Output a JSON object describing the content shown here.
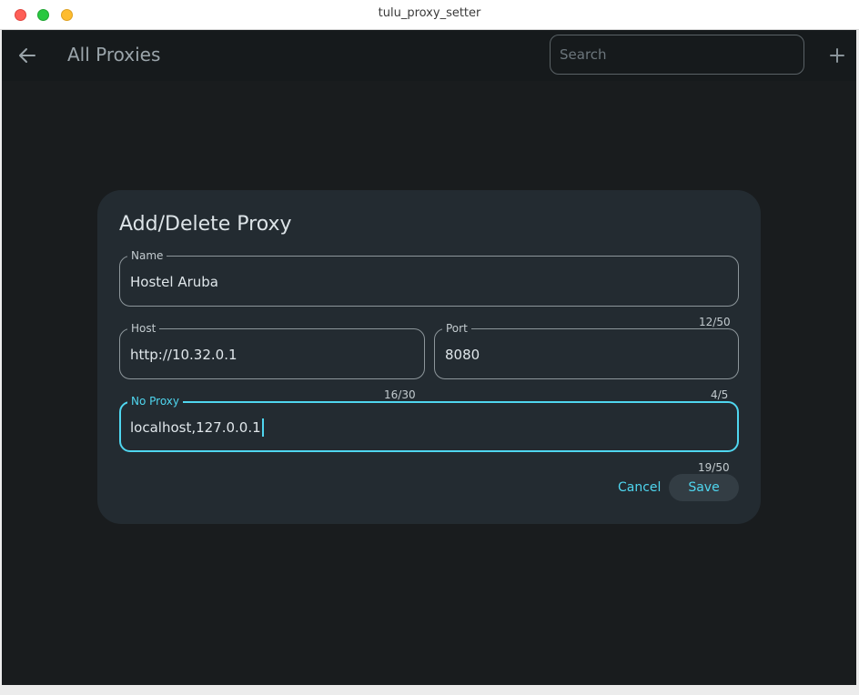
{
  "window": {
    "title": "tulu_proxy_setter"
  },
  "appbar": {
    "back_icon": "arrow-left-icon",
    "title": "All Proxies",
    "search_placeholder": "Search",
    "search_value": "",
    "add_icon": "plus-icon"
  },
  "dialog": {
    "title": "Add/Delete Proxy",
    "name": {
      "label": "Name",
      "value": "Hostel Aruba",
      "counter": "12/50"
    },
    "host": {
      "label": "Host",
      "value": "http://10.32.0.1",
      "counter": "16/30"
    },
    "port": {
      "label": "Port",
      "value": "8080",
      "counter": "4/5"
    },
    "no_proxy": {
      "label": "No Proxy",
      "value": "localhost,127.0.0.1",
      "counter": "19/50"
    },
    "cancel_label": "Cancel",
    "save_label": "Save"
  },
  "colors": {
    "accent": "#4fd6ef",
    "background": "#191c1e",
    "dialog": "#232b31"
  }
}
